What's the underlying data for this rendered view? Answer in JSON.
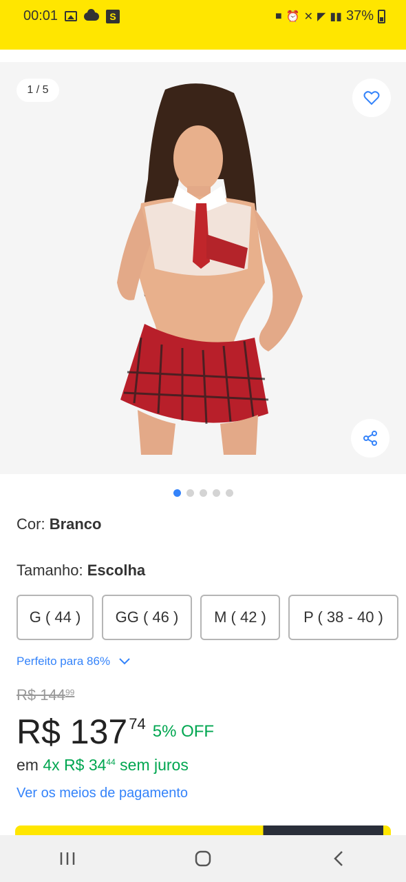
{
  "status_bar": {
    "time": "00:01",
    "battery": "37%"
  },
  "gallery": {
    "counter": "1 / 5",
    "total_dots": 5,
    "active_dot": 0
  },
  "attributes": {
    "color_label": "Cor:",
    "color_value": "Branco",
    "size_label": "Tamanho:",
    "size_value": "Escolha"
  },
  "sizes": [
    "G ( 44 )",
    "GG ( 46 )",
    "M ( 42 )",
    "P ( 38 - 40 )"
  ],
  "fit": {
    "text": "Perfeito para 86%"
  },
  "price": {
    "old_integer": "R$ 144",
    "old_cents": "99",
    "integer": "R$ 137",
    "cents": "74",
    "discount": "5% OFF"
  },
  "installments": {
    "prefix": "em ",
    "count": "4x R$ 34",
    "cents": "44",
    "suffix": " sem juros"
  },
  "payment_link": "Ver os meios de pagamento",
  "colors": {
    "brand_yellow": "#ffe600",
    "link_blue": "#3483fa",
    "green": "#00a650"
  },
  "icons": {
    "favorite": "heart-icon",
    "share": "share-icon",
    "fit_expand": "chevron-down-icon",
    "nav_recent": "recent-apps-icon",
    "nav_home": "home-icon",
    "nav_back": "back-icon"
  }
}
